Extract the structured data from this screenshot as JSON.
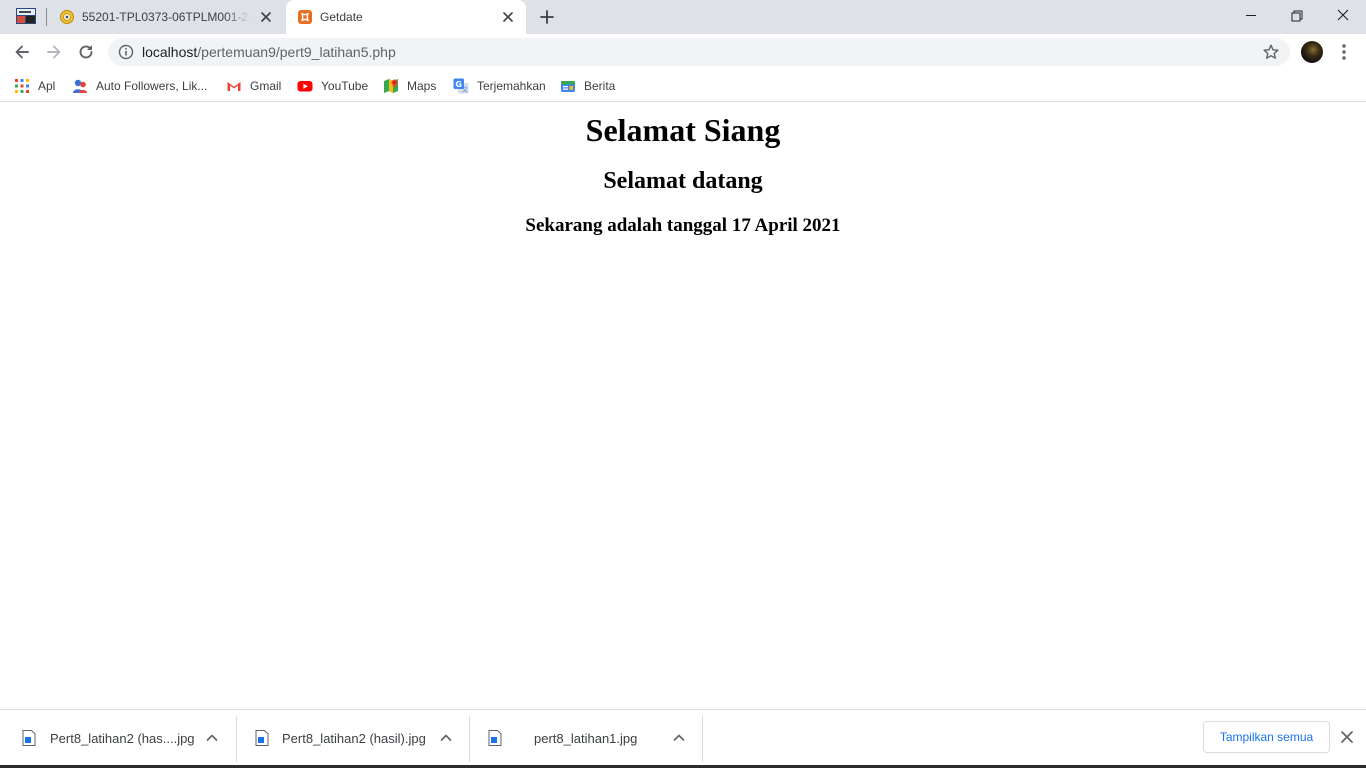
{
  "browser": {
    "tabs": [
      {
        "title": "55201-TPL0373-06TPLM001-2020",
        "active": false,
        "favicon": "university-seal-icon"
      },
      {
        "title": "Getdate",
        "active": true,
        "favicon": "xampp-icon"
      }
    ],
    "address": {
      "host": "localhost",
      "path": "/pertemuan9/pert9_latihan5.php"
    },
    "bookmarks": [
      {
        "label": "Apl",
        "icon": "apps-grid-icon"
      },
      {
        "label": "Auto Followers, Lik...",
        "icon": "followers-icon"
      },
      {
        "label": "Gmail",
        "icon": "gmail-icon"
      },
      {
        "label": "YouTube",
        "icon": "youtube-icon"
      },
      {
        "label": "Maps",
        "icon": "maps-icon"
      },
      {
        "label": "Terjemahkan",
        "icon": "translate-icon"
      },
      {
        "label": "Berita",
        "icon": "news-icon"
      }
    ]
  },
  "page": {
    "h1": "Selamat Siang",
    "h2": "Selamat datang",
    "h3": "Sekarang adalah tanggal 17 April 2021"
  },
  "downloads": {
    "items": [
      {
        "filename": "Pert8_latihan2 (has....jpg"
      },
      {
        "filename": "Pert8_latihan2 (hasil).jpg"
      },
      {
        "filename": "pert8_latihan1.jpg"
      }
    ],
    "show_all_label": "Tampilkan semua"
  },
  "colors": {
    "tabstrip": "#dee1e6",
    "link_blue": "#1a73e8",
    "omnibox": "#f1f3f4"
  }
}
